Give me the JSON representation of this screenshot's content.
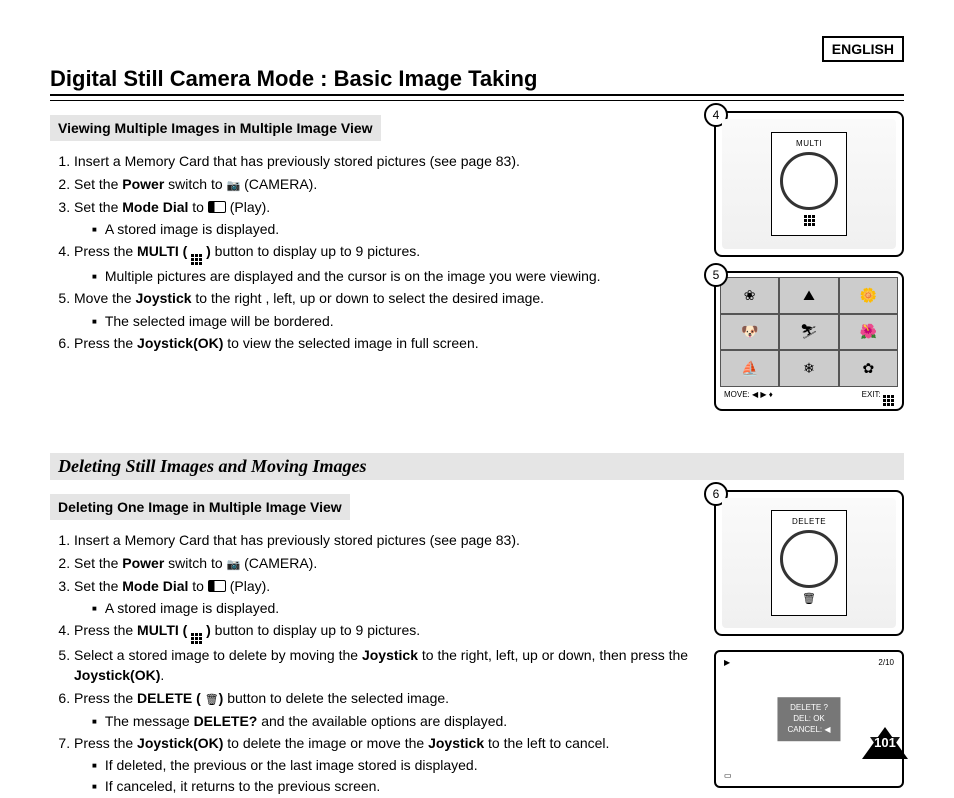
{
  "lang": "ENGLISH",
  "title": "Digital Still Camera Mode : Basic Image Taking",
  "page_number": "101",
  "section1": {
    "head": "Viewing Multiple Images in Multiple Image View",
    "s1": "Insert a Memory Card that has previously stored pictures (see page 83).",
    "s2a": "Set the ",
    "s2b": "Power",
    "s2c": " switch to ",
    "s2d": "(CAMERA).",
    "s3a": "Set the ",
    "s3b": "Mode Dial",
    "s3c": " to ",
    "s3d": "(Play).",
    "s3sub": "A stored image is displayed.",
    "s4a": "Press the ",
    "s4b": "MULTI ( ",
    "s4c": " )",
    "s4d": " button to display up to 9 pictures.",
    "s4sub": "Multiple pictures are displayed and the cursor is on the image you were viewing.",
    "s5a": "Move the ",
    "s5b": "Joystick",
    "s5c": " to the right , left, up or down to select the desired image.",
    "s5sub": "The selected image will be bordered.",
    "s6a": "Press the ",
    "s6b": "Joystick(OK)",
    "s6c": " to view the selected image in full screen."
  },
  "section_title2": "Deleting Still Images and Moving Images",
  "section2": {
    "head": "Deleting One Image in Multiple Image View",
    "s1": "Insert a Memory Card that has previously stored pictures (see page 83).",
    "s2a": "Set the ",
    "s2b": "Power",
    "s2c": " switch to ",
    "s2d": "(CAMERA).",
    "s3a": "Set the ",
    "s3b": "Mode Dial",
    "s3c": " to ",
    "s3d": "(Play).",
    "s3sub": "A stored image is displayed.",
    "s4a": "Press the ",
    "s4b": "MULTI ( ",
    "s4c": " )",
    "s4d": " button to display up to 9 pictures.",
    "s5a": "Select a stored image to delete by moving the ",
    "s5b": "Joystick",
    "s5c": " to the right, left, up or down, then press the ",
    "s5d": "Joystick(OK)",
    "s5e": ".",
    "s6a": "Press the ",
    "s6b": "DELETE ( ",
    "s6c": ")",
    "s6d": " button to delete the selected image.",
    "s6sub_a": "The message ",
    "s6sub_b": "DELETE?",
    "s6sub_c": " and the available options are displayed.",
    "s7a": "Press the ",
    "s7b": "Joystick(OK)",
    "s7c": " to delete the image or move the ",
    "s7d": "Joystick",
    "s7e": " to the left to cancel.",
    "s7sub1": "If deleted, the previous or the last image stored is displayed.",
    "s7sub2": "If canceled, it returns to the previous screen."
  },
  "fig": {
    "b4": "4",
    "b5": "5",
    "b6": "6",
    "label_multi": "MULTI",
    "label_delete": "DELETE",
    "move": "MOVE: ◀ ▶ ♦",
    "exit": "EXIT: ",
    "lcd_counter": "2/10",
    "dlg_q": "DELETE ?",
    "dlg_ok": "DEL: OK",
    "dlg_cancel": "CANCEL: ◀"
  },
  "thumbs": [
    "❀",
    "⛰",
    "🌼",
    "🐶",
    "⛷",
    "🌺",
    "⛵",
    "❄",
    "✿"
  ]
}
